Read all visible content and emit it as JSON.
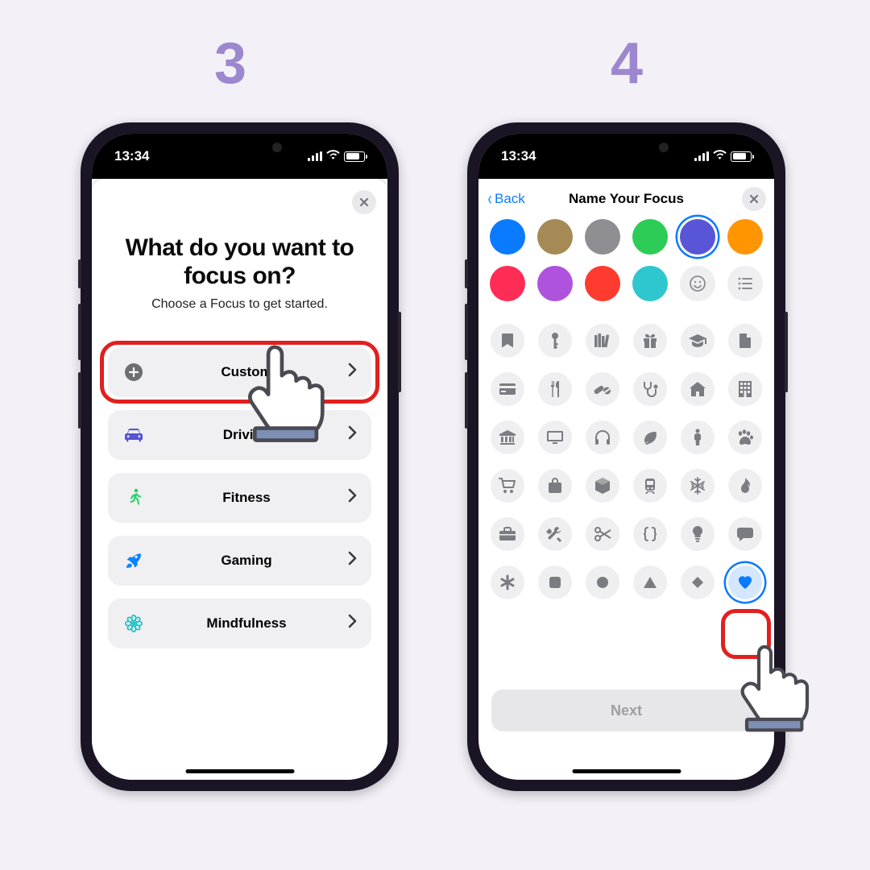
{
  "steps": {
    "left": "3",
    "right": "4"
  },
  "status": {
    "time": "13:34"
  },
  "screen1": {
    "title": "What do you want to focus on?",
    "subtitle": "Choose a Focus to get started.",
    "options": [
      {
        "id": "custom",
        "label": "Custom",
        "iconColor": "#6d6d74"
      },
      {
        "id": "driving",
        "label": "Driving",
        "iconColor": "#5654d4"
      },
      {
        "id": "fitness",
        "label": "Fitness",
        "iconColor": "#2fcf6e"
      },
      {
        "id": "gaming",
        "label": "Gaming",
        "iconColor": "#0a84ff"
      },
      {
        "id": "mindfulness",
        "label": "Mindfulness",
        "iconColor": "#25c3c9"
      }
    ],
    "highlightedOption": "custom"
  },
  "screen2": {
    "back": "Back",
    "title": "Name Your Focus",
    "colors": [
      "#0a7aff",
      "#a68a56",
      "#8e8e93",
      "#2dcc57",
      "#5856d6",
      "#ff9500",
      "#ff2d55",
      "#af52de",
      "#ff3b30",
      "#2ec7cf"
    ],
    "selectedColorIndex": 4,
    "extraChips": [
      "emoji",
      "list"
    ],
    "iconRows": [
      [
        "bookmark",
        "key",
        "books",
        "gift",
        "grad-cap",
        "document"
      ],
      [
        "credit-card",
        "fork-knife",
        "pills",
        "stethoscope",
        "house",
        "building"
      ],
      [
        "bank",
        "display",
        "headphones",
        "leaf",
        "person",
        "paw"
      ],
      [
        "cart",
        "bag",
        "box",
        "tram",
        "snowflake",
        "flame"
      ],
      [
        "briefcase",
        "tools",
        "scissors",
        "braces",
        "lightbulb",
        "speech"
      ],
      [
        "asterisk",
        "square",
        "circle",
        "triangle",
        "diamond",
        "heart"
      ]
    ],
    "selectedIcon": "heart",
    "nextLabel": "Next"
  }
}
